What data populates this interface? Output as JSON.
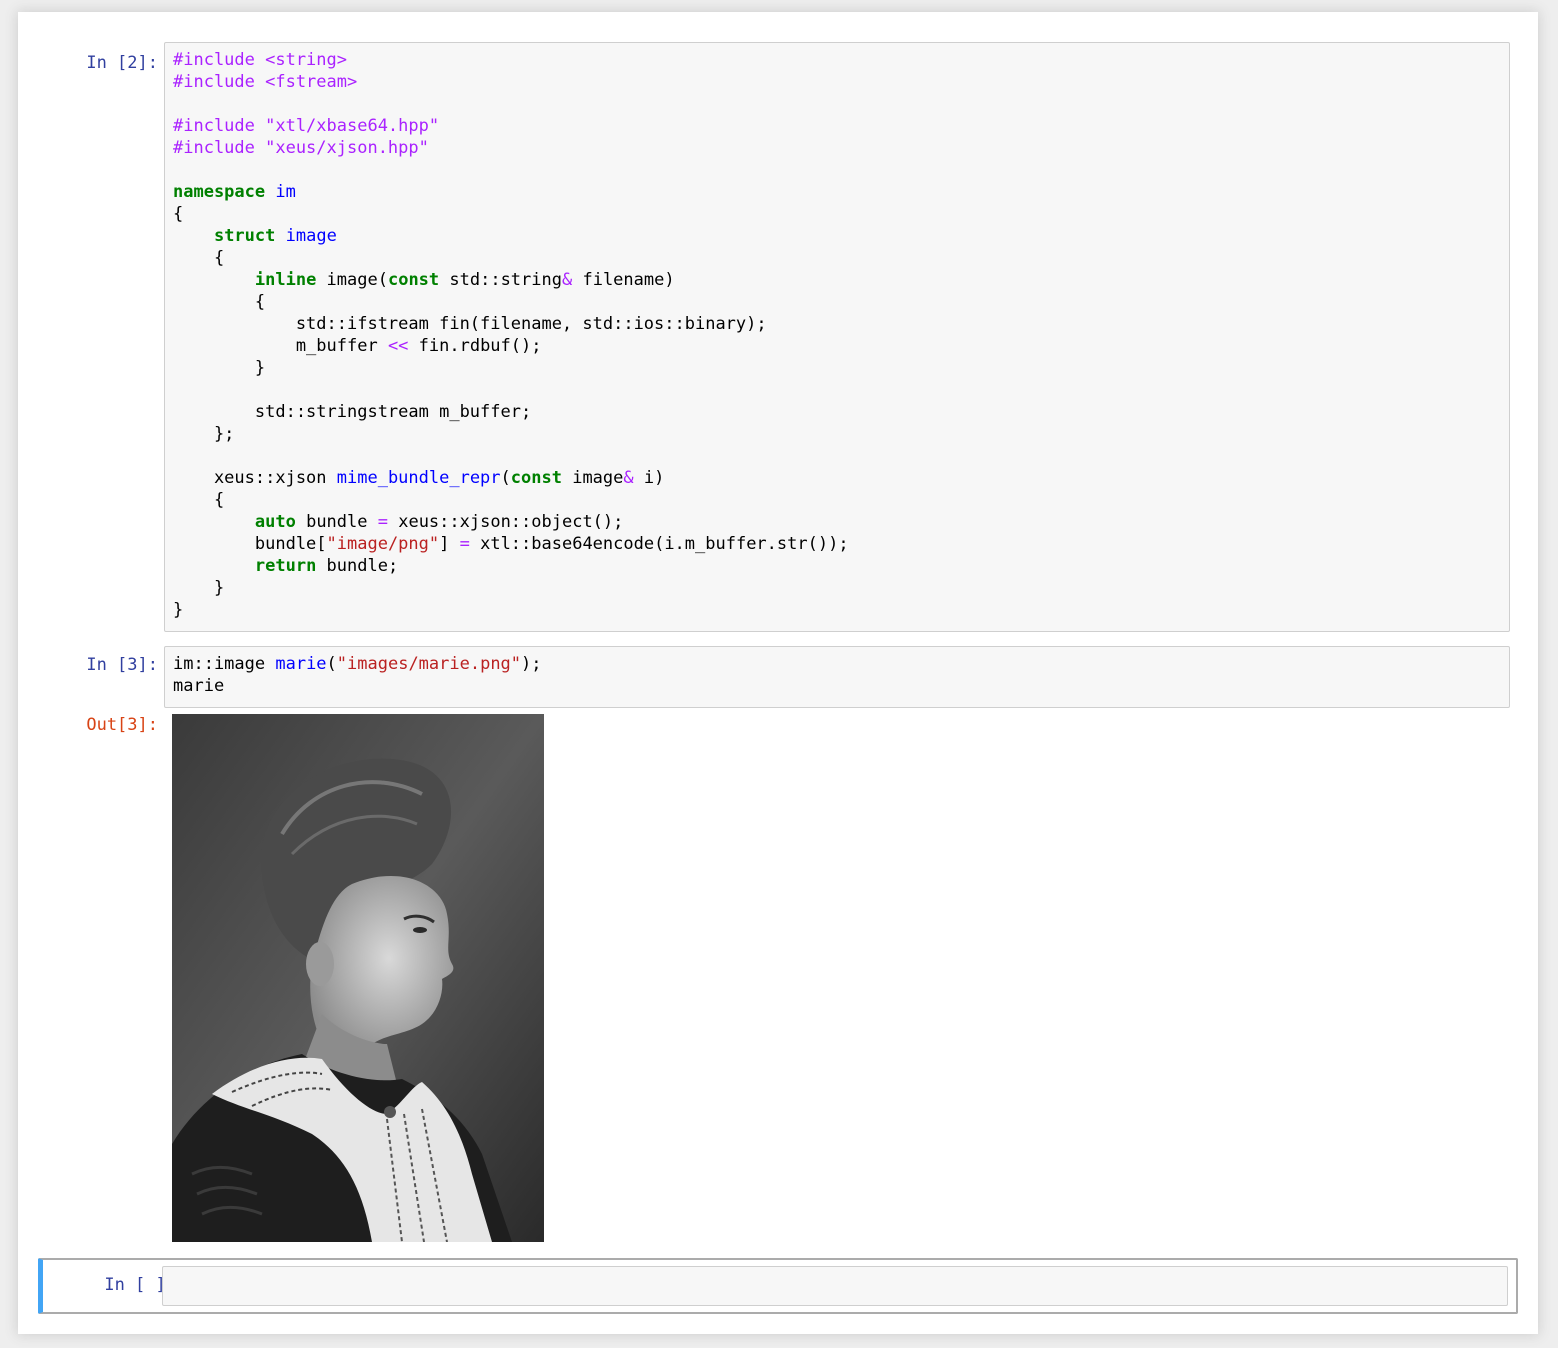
{
  "cells": [
    {
      "prompt": "In [2]:",
      "lines": [
        [
          [
            "meta",
            "#include <string>"
          ]
        ],
        [
          [
            "meta",
            "#include <fstream>"
          ]
        ],
        [],
        [
          [
            "meta",
            "#include \"xtl/xbase64.hpp\""
          ]
        ],
        [
          [
            "meta",
            "#include \"xeus/xjson.hpp\""
          ]
        ],
        [],
        [
          [
            "kw",
            "namespace"
          ],
          [
            "",
            " "
          ],
          [
            "def",
            "im"
          ]
        ],
        [
          [
            "",
            "{"
          ]
        ],
        [
          [
            "",
            "    "
          ],
          [
            "kw",
            "struct"
          ],
          [
            "",
            " "
          ],
          [
            "def",
            "image"
          ]
        ],
        [
          [
            "",
            "    {"
          ]
        ],
        [
          [
            "",
            "        "
          ],
          [
            "kw",
            "inline"
          ],
          [
            "",
            " image("
          ],
          [
            "kw",
            "const"
          ],
          [
            "",
            " std::string"
          ],
          [
            "op",
            "&"
          ],
          [
            "",
            " filename)"
          ]
        ],
        [
          [
            "",
            "        {"
          ]
        ],
        [
          [
            "",
            "            std::ifstream fin(filename, std::ios::binary);"
          ]
        ],
        [
          [
            "",
            "            m_buffer "
          ],
          [
            "op",
            "<<"
          ],
          [
            "",
            " fin.rdbuf();"
          ]
        ],
        [
          [
            "",
            "        }"
          ]
        ],
        [],
        [
          [
            "",
            "        std::stringstream m_buffer;"
          ]
        ],
        [
          [
            "",
            "    };"
          ]
        ],
        [],
        [
          [
            "",
            "    xeus::xjson "
          ],
          [
            "def",
            "mime_bundle_repr"
          ],
          [
            "",
            "("
          ],
          [
            "kw",
            "const"
          ],
          [
            "",
            " image"
          ],
          [
            "op",
            "&"
          ],
          [
            "",
            " i)"
          ]
        ],
        [
          [
            "",
            "    {"
          ]
        ],
        [
          [
            "",
            "        "
          ],
          [
            "kw",
            "auto"
          ],
          [
            "",
            " bundle "
          ],
          [
            "op",
            "="
          ],
          [
            "",
            " xeus::xjson::object();"
          ]
        ],
        [
          [
            "",
            "        bundle["
          ],
          [
            "str",
            "\"image/png\""
          ],
          [
            "",
            "] "
          ],
          [
            "op",
            "="
          ],
          [
            "",
            " xtl::base64encode(i.m_buffer.str());"
          ]
        ],
        [
          [
            "",
            "        "
          ],
          [
            "kw",
            "return"
          ],
          [
            "",
            " bundle;"
          ]
        ],
        [
          [
            "",
            "    }"
          ]
        ],
        [
          [
            "",
            "}"
          ]
        ]
      ]
    },
    {
      "prompt": "In [3]:",
      "lines": [
        [
          [
            "",
            "im::image "
          ],
          [
            "def",
            "marie"
          ],
          [
            "",
            "("
          ],
          [
            "str",
            "\"images/marie.png\""
          ],
          [
            "",
            ");"
          ]
        ],
        [
          [
            "",
            "marie"
          ]
        ]
      ],
      "output": {
        "prompt": "Out[3]:",
        "image": "portrait-photo"
      }
    },
    {
      "prompt": "In [ ]:",
      "lines": []
    }
  ],
  "colors": {
    "in_prompt": "#303f9f",
    "out_prompt": "#d84315",
    "meta": "#aa22ff",
    "keyword": "#008000",
    "definition": "#0000ff",
    "string": "#ba2121",
    "selected_cell_bar": "#42a5f5"
  }
}
